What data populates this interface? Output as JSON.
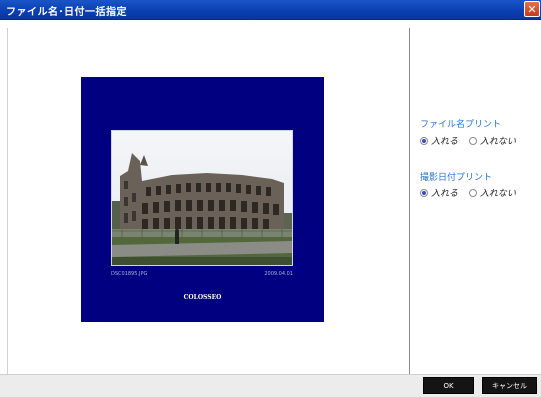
{
  "window": {
    "title": "ファイル名･日付一括指定",
    "close_icon": "close-icon"
  },
  "preview": {
    "card_bg": "#000080",
    "photo": {
      "file_name": "DSC01895.JPG",
      "date": "2009.04.01",
      "title": "COLOSSEO"
    }
  },
  "options": {
    "filename_print": {
      "label": "ファイル名プリント",
      "choices": [
        "入れる",
        "入れない"
      ],
      "selected": "入れる"
    },
    "date_print": {
      "label": "撮影日付プリント",
      "choices": [
        "入れる",
        "入れない"
      ],
      "selected": "入れる"
    }
  },
  "footer": {
    "ok_label": "OK",
    "cancel_label": "キャンセル"
  }
}
